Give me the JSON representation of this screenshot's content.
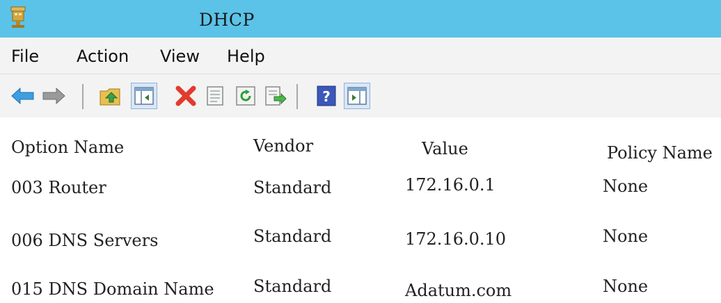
{
  "window": {
    "title": "DHCP",
    "icon": "dhcp-server-icon"
  },
  "menu": {
    "file": "File",
    "action": "Action",
    "view": "View",
    "help": "Help"
  },
  "toolbar": {
    "buttons": [
      "back-arrow-icon",
      "forward-arrow-icon",
      "up-folder-icon",
      "show-hide-console-tree-icon",
      "delete-icon",
      "properties-icon",
      "refresh-icon",
      "export-list-icon",
      "help-icon",
      "show-hide-action-pane-icon"
    ]
  },
  "columns": {
    "option_name": "Option Name",
    "vendor": "Vendor",
    "value": "Value",
    "policy_name": "Policy Name"
  },
  "rows": [
    {
      "option_name": "003 Router",
      "vendor": "Standard",
      "value": "172.16.0.1",
      "policy_name": "None"
    },
    {
      "option_name": "006 DNS Servers",
      "vendor": "Standard",
      "value": "172.16.0.10",
      "policy_name": "None"
    },
    {
      "option_name": "015 DNS Domain Name",
      "vendor": "Standard",
      "value": "Adatum.com",
      "policy_name": "None"
    }
  ],
  "colors": {
    "titlebar": "#5bc3e8",
    "menubar": "#f3f3f3",
    "delete": "#e23b2e",
    "help": "#3b57b8"
  }
}
